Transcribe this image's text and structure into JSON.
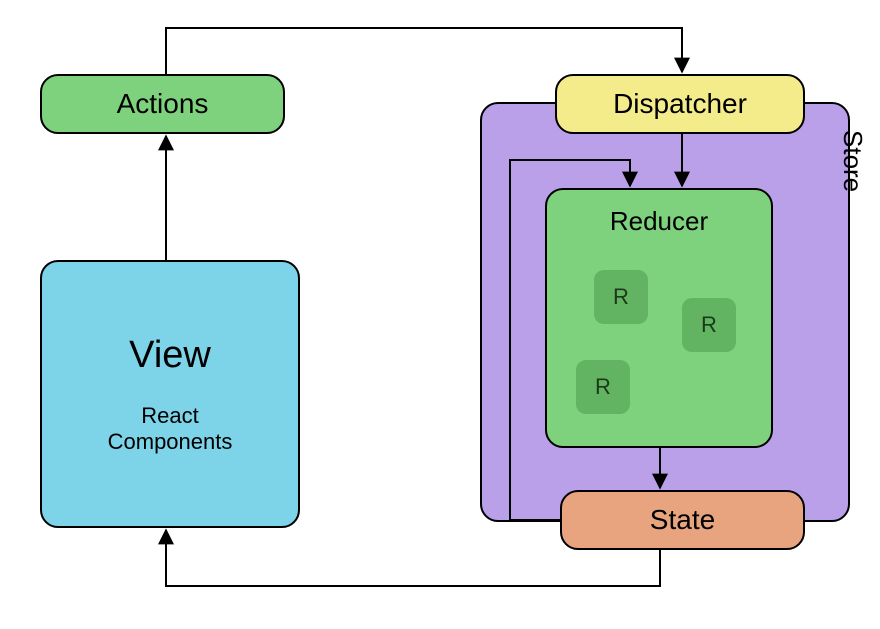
{
  "nodes": {
    "actions": {
      "label": "Actions"
    },
    "dispatcher": {
      "label": "Dispatcher"
    },
    "store": {
      "label": "Store"
    },
    "reducer": {
      "label": "Reducer",
      "children": [
        "R",
        "R",
        "R"
      ]
    },
    "state": {
      "label": "State"
    },
    "view": {
      "title": "View",
      "subtitle": "React\nComponents"
    }
  },
  "edges": [
    {
      "from": "view",
      "to": "actions"
    },
    {
      "from": "actions",
      "to": "dispatcher"
    },
    {
      "from": "dispatcher",
      "to": "reducer"
    },
    {
      "from": "reducer",
      "to": "state"
    },
    {
      "from": "state",
      "to": "view"
    },
    {
      "from": "state",
      "to": "reducer",
      "note": "feedback loop"
    }
  ],
  "colors": {
    "actions": "#7ed27e",
    "dispatcher": "#f4eb8b",
    "store": "#b9a0e8",
    "reducer": "#7ed27e",
    "reducer_child": "#62b362",
    "state": "#e7a47f",
    "view": "#7dd3e8"
  }
}
